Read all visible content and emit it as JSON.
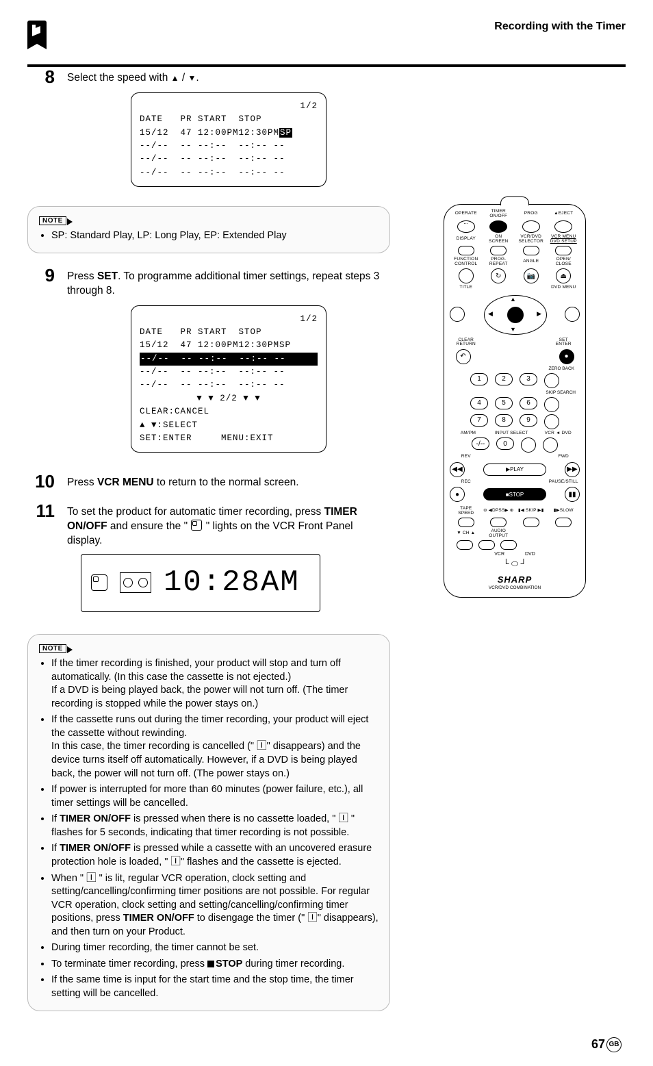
{
  "header": {
    "section_title": "Recording with the Timer"
  },
  "steps": {
    "s8": {
      "num": "8",
      "text_a": "Select the speed with ",
      "text_b": " / ",
      "text_c": "."
    },
    "s9": {
      "num": "9",
      "text_a": "Press ",
      "bold": "SET",
      "text_b": ". To programme additional timer settings, repeat steps 3 through 8."
    },
    "s10": {
      "num": "10",
      "text_a": "Press ",
      "bold": "VCR MENU",
      "text_b": " to return to the normal screen."
    },
    "s11": {
      "num": "11",
      "text_a": "To set the product for automatic timer recording, press ",
      "bold1": "TIMER ON/OFF",
      "text_b": " and ensure the \" ",
      "text_c": " \" lights on the VCR Front Panel display."
    }
  },
  "osd1": {
    "page": "1/2",
    "hdr": "DATE   PR START  STOP",
    "r1a": "15/12  47 12:00PM12:30PM",
    "r1b": "SP",
    "r2": "--/--  -- --:--  --:-- --",
    "r3": "--/--  -- --:--  --:-- --",
    "r4": "--/--  -- --:--  --:-- --"
  },
  "osd2": {
    "page": "1/2",
    "hdr": "DATE   PR START  STOP",
    "r1": "15/12  47 12:00PM12:30PMSP",
    "r2": "--/--  -- --:--  --:-- --",
    "r3": "--/--  -- --:--  --:-- --",
    "r4": "--/--  -- --:--  --:-- --",
    "pg": "▼ ▼ 2/2 ▼ ▼",
    "l1": "CLEAR:CANCEL",
    "l2": "▲ ▼:SELECT",
    "l3a": "SET:ENTER",
    "l3b": "MENU:EXIT"
  },
  "note1": {
    "tag": "NOTE",
    "item": "SP: Standard Play, LP: Long Play, EP: Extended Play"
  },
  "lcd": {
    "digits": "10:28AM"
  },
  "note2": {
    "tag": "NOTE",
    "items": [
      {
        "t": "If the timer recording is finished, your product will stop and turn off automatically. (In this case the cassette is not ejected.)\nIf a DVD is being played back, the power will not turn off. (The timer recording is stopped while the power stays on.)"
      },
      {
        "t": "If the cassette runs out during the timer recording, your product will eject the cassette without rewinding.\nIn this case, the timer recording is cancelled (\" 🄸\" disappears) and the device turns itself off automatically. However, if a DVD is being played back, the power will not turn off. (The power stays on.)"
      },
      {
        "t": "If power is interrupted for more than 60 minutes (power failure, etc.), all timer settings will be cancelled."
      },
      {
        "pre": "If ",
        "b": "TIMER ON/OFF",
        "post": " is pressed when there is no cassette loaded, \" 🄸 \" flashes for 5 seconds, indicating that timer recording is not possible."
      },
      {
        "pre": "If ",
        "b": "TIMER ON/OFF",
        "post": " is pressed while a cassette with an uncovered erasure protection hole is loaded, \" 🄸\" flashes and the cassette is ejected."
      },
      {
        "pre": "When \" 🄸 \" is lit, regular VCR operation, clock setting and setting/cancelling/confirming timer positions are not possible. For regular VCR operation, clock setting and setting/cancelling/confirming timer positions, press ",
        "b": "TIMER ON/OFF",
        "post": " to disengage the timer (\" 🄸\" disappears), and then turn on your Product."
      },
      {
        "t": "During timer recording, the timer cannot be set."
      },
      {
        "pre": "To terminate timer recording, press ",
        "stop": "STOP",
        "post": " during timer recording."
      },
      {
        "t": "If the same time is input for the start time and the stop time, the timer setting will be cancelled."
      }
    ]
  },
  "remote": {
    "row1": [
      "OPERATE",
      "TIMER\nON/OFF",
      "PROG",
      "▲EJECT"
    ],
    "row2": [
      "DISPLAY",
      "ON\nSCREEN",
      "VCR/DVD\nSELECTOR",
      "VCR MENU\nDVD SETUP"
    ],
    "row3": [
      "FUNCTION\nCONTROL",
      "PROG.\nREPEAT",
      "ANGLE",
      "OPEN/\nCLOSE"
    ],
    "row4l": "TITLE",
    "row4r": "DVD MENU",
    "row5l": "CLEAR\nRETURN",
    "row5r": "SET\nENTER",
    "zero_back": "ZERO BACK",
    "nums": [
      "1",
      "2",
      "3",
      "4",
      "5",
      "6",
      "7",
      "8",
      "9",
      "0"
    ],
    "skip_search": "SKIP SEARCH",
    "ampm": "AM/PM",
    "input_sel": "INPUT SELECT",
    "vcrdvd": "VCR ◄ DVD",
    "slash": "-/--",
    "rev": "REV",
    "fwd": "FWD",
    "play": "▶PLAY",
    "rec": "REC",
    "stop": "■STOP",
    "pause": "PAUSE/STILL",
    "tape_speed": "TAPE\nSPEED",
    "dpss": "DPSS",
    "skip": "SKIP",
    "slow": "SLOW",
    "ch": "CH",
    "audio": "AUDIO\nOUTPUT",
    "vcr_dvd_label_l": "VCR",
    "vcr_dvd_label_r": "DVD",
    "brand": "SHARP",
    "brand_sub": "VCR/DVD COMBINATION"
  },
  "footer": {
    "page": "67",
    "gb": "GB"
  }
}
